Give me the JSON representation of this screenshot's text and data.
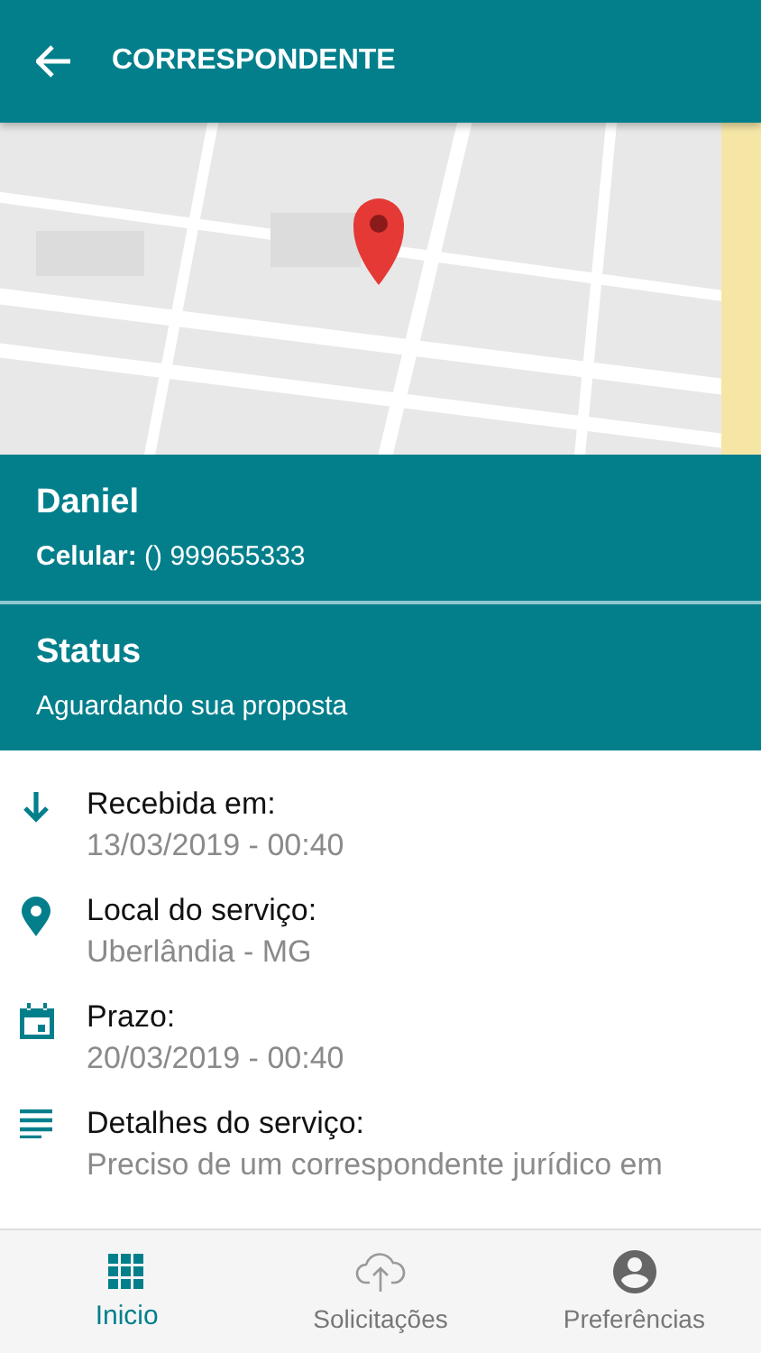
{
  "header": {
    "title": "CORRESPONDENTE"
  },
  "contact": {
    "name": "Daniel",
    "phone_label": "Celular:",
    "phone": "() 999655333"
  },
  "status": {
    "title": "Status",
    "text": "Aguardando sua proposta"
  },
  "details": [
    {
      "kind": "received",
      "label": "Recebida em:",
      "value": "13/03/2019 - 00:40"
    },
    {
      "kind": "location",
      "label": "Local do serviço:",
      "value": "Uberlândia - MG"
    },
    {
      "kind": "deadline",
      "label": "Prazo:",
      "value": "20/03/2019 - 00:40"
    },
    {
      "kind": "details",
      "label": "Detalhes do serviço:",
      "value": "Preciso de um correspondente jurídico em"
    }
  ],
  "nav": [
    {
      "kind": "home",
      "label": "Inicio",
      "selected": true
    },
    {
      "kind": "upload",
      "label": "Solicitações",
      "selected": false
    },
    {
      "kind": "profile",
      "label": "Preferências",
      "selected": false
    }
  ]
}
